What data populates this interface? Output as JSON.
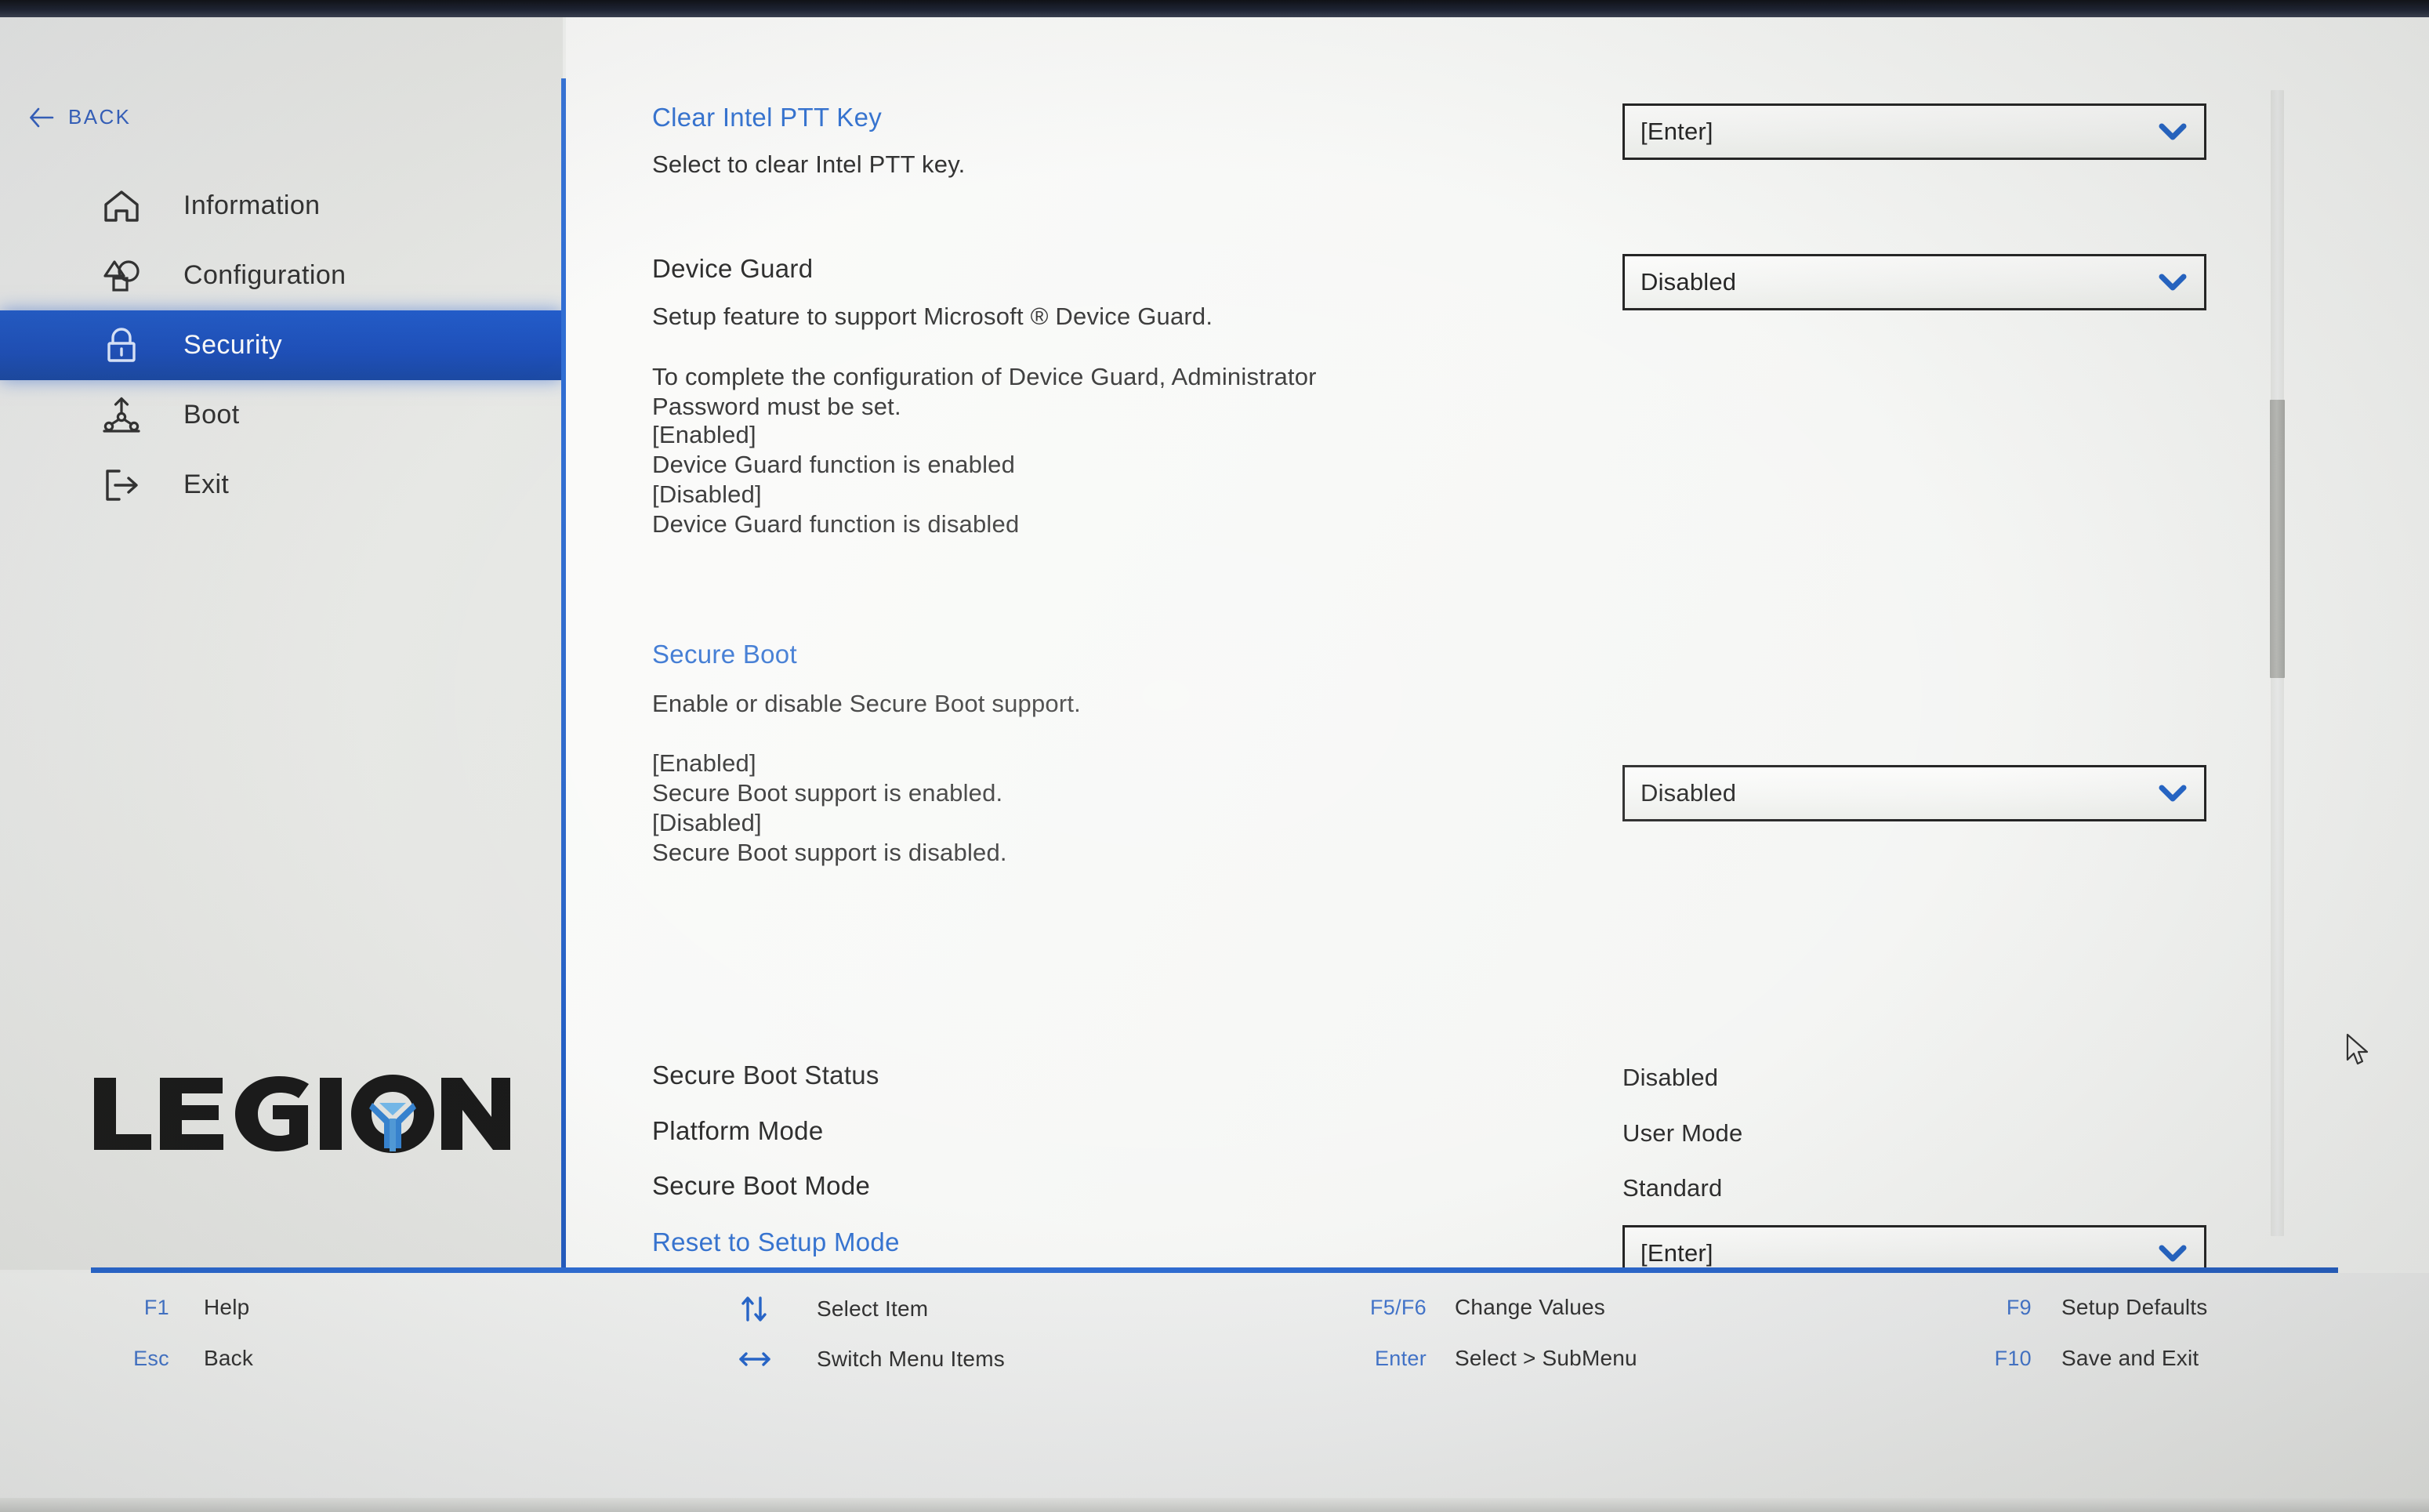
{
  "nav": {
    "back_label": "BACK",
    "back_icon": "arrow-left-icon",
    "items": [
      {
        "label": "Information",
        "icon": "home-icon",
        "active": false
      },
      {
        "label": "Configuration",
        "icon": "shapes-icon",
        "active": false
      },
      {
        "label": "Security",
        "icon": "padlock-icon",
        "active": true
      },
      {
        "label": "Boot",
        "icon": "boot-network-icon",
        "active": false
      },
      {
        "label": "Exit",
        "icon": "exit-arrow-icon",
        "active": false
      }
    ],
    "brand": "LEGION"
  },
  "settings": {
    "clear_ptt": {
      "title": "Clear Intel PTT Key",
      "desc": "Select to clear Intel PTT key.",
      "value": "[Enter]"
    },
    "device_guard": {
      "title": "Device Guard",
      "desc1": "Setup feature to support Microsoft ® Device Guard.",
      "desc2": "To complete the configuration of Device Guard, Administrator\nPassword must be set.",
      "opt_enabled_tag": "[Enabled]",
      "opt_enabled_text": "Device Guard function is enabled",
      "opt_disabled_tag": "[Disabled]",
      "opt_disabled_text": "Device Guard function is disabled",
      "value": "Disabled"
    },
    "secure_boot": {
      "title": "Secure Boot",
      "desc": "Enable or disable Secure Boot support.",
      "opt_enabled_tag": "[Enabled]",
      "opt_enabled_text": "Secure Boot support is enabled.",
      "opt_disabled_tag": "[Disabled]",
      "opt_disabled_text": "Secure Boot support is disabled.",
      "value": "Disabled"
    },
    "secure_boot_status": {
      "title": "Secure Boot Status",
      "value": "Disabled"
    },
    "platform_mode": {
      "title": "Platform Mode",
      "value": "User Mode"
    },
    "secure_boot_mode": {
      "title": "Secure Boot Mode",
      "value": "Standard"
    },
    "reset_setup_mode": {
      "title": "Reset to Setup Mode",
      "value": "[Enter]"
    }
  },
  "footer": {
    "hints": [
      {
        "key": "F1",
        "action": "Help",
        "icon": ""
      },
      {
        "key": "Esc",
        "action": "Back",
        "icon": ""
      },
      {
        "key": "",
        "action": "Select Item",
        "icon": "up-down-arrows-icon"
      },
      {
        "key": "",
        "action": "Switch Menu Items",
        "icon": "left-right-arrows-icon"
      },
      {
        "key": "F5/F6",
        "action": "Change Values",
        "icon": ""
      },
      {
        "key": "Enter",
        "action": "Select > SubMenu",
        "icon": ""
      },
      {
        "key": "F9",
        "action": "Setup Defaults",
        "icon": ""
      },
      {
        "key": "F10",
        "action": "Save and Exit",
        "icon": ""
      }
    ]
  },
  "colors": {
    "accent_blue": "#1a56c8",
    "link_blue": "#2f6fd0",
    "key_blue": "#3b6fc9",
    "sidebar_bg": "#e7e8e5",
    "content_bg": "#f7f8f6"
  }
}
